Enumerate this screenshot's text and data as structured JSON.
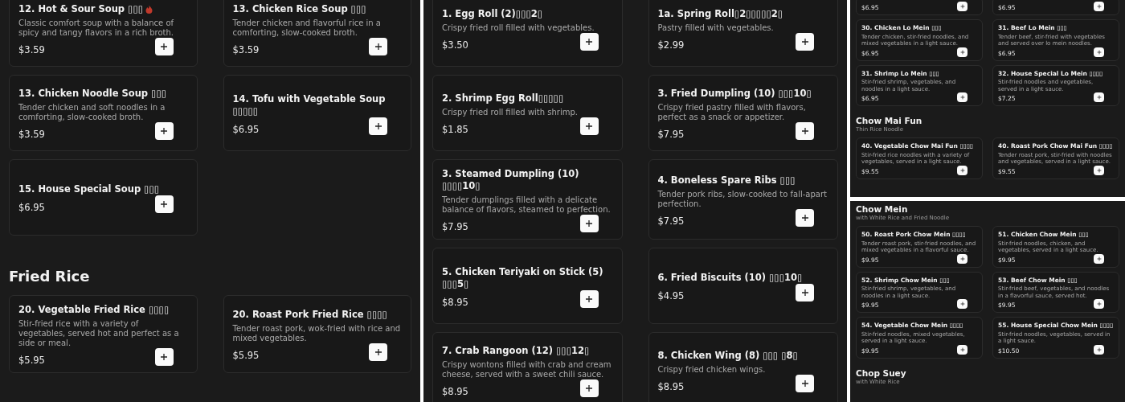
{
  "views": [
    {
      "kind": "large",
      "sections": [
        {
          "items": [
            {
              "name": "12. Hot & Sour Soup ▯▯▯",
              "spicy": true,
              "description": "Classic comfort soup with a balance of spicy and tangy flavors in a rich broth.",
              "price": "$3.59"
            },
            {
              "name": "13. Chicken Rice Soup ▯▯▯",
              "spicy": false,
              "description": "Tender chicken and flavorful rice in a comforting, slow-cooked broth.",
              "price": "$3.59"
            },
            {
              "name": "13. Chicken Noodle Soup ▯▯▯",
              "spicy": false,
              "description": "Tender chicken and soft noodles in a comforting, slow-cooked broth.",
              "price": "$3.59"
            },
            {
              "name": "14. Tofu with Vegetable Soup ▯▯▯▯▯",
              "spicy": false,
              "price": "$6.95"
            },
            {
              "name": "15. House Special Soup ▯▯▯",
              "spicy": false,
              "price": "$6.95"
            }
          ]
        },
        {
          "title": "Fried Rice",
          "items": [
            {
              "name": "20. Vegetable Fried Rice ▯▯▯▯",
              "spicy": false,
              "description": "Stir-fried rice with a variety of vegetables, served hot and perfect as a side or meal.",
              "price": "$5.95"
            },
            {
              "name": "20. Roast Pork Fried Rice ▯▯▯▯",
              "spicy": false,
              "description": "Tender roast pork, wok-fried with rice and mixed vegetables.",
              "price": "$5.95"
            }
          ]
        }
      ]
    },
    {
      "kind": "large",
      "sections": [
        {
          "items": [
            {
              "name": "1. Egg Roll (2)▯▯▯2▯",
              "spicy": false,
              "description": "Crispy fried roll filled with vegetables.",
              "price": "$3.50"
            },
            {
              "name": "1a. Spring Roll▯2▯▯▯▯▯2▯",
              "spicy": false,
              "description": "Pastry filled with vegetables.",
              "price": "$2.99"
            },
            {
              "name": "2. Shrimp Egg Roll▯▯▯▯▯",
              "spicy": false,
              "description": "Crispy fried roll filled with shrimp.",
              "price": "$1.85"
            },
            {
              "name": "3. Fried Dumpling (10) ▯▯▯10▯",
              "spicy": false,
              "description": "Crispy fried pastry filled with flavors, perfect as a snack or appetizer.",
              "price": "$7.95"
            },
            {
              "name": "3. Steamed Dumpling (10) ▯▯▯▯10▯",
              "spicy": false,
              "description": "Tender dumplings filled with a delicate balance of flavors, steamed to perfection.",
              "price": "$7.95"
            },
            {
              "name": "4. Boneless Spare Ribs ▯▯▯",
              "spicy": false,
              "description": "Tender pork ribs, slow-cooked to fall-apart perfection.",
              "price": "$7.95"
            },
            {
              "name": "5. Chicken Teriyaki on Stick (5) ▯▯▯5▯",
              "spicy": false,
              "price": "$8.95"
            },
            {
              "name": "6. Fried Biscuits (10) ▯▯▯10▯",
              "spicy": false,
              "price": "$4.95"
            },
            {
              "name": "7. Crab Rangoon (12) ▯▯▯12▯",
              "spicy": false,
              "description": "Crispy wontons filled with crab and cream cheese, served with a sweet chili sauce.",
              "price": "$8.95"
            },
            {
              "name": "8. Chicken Wing (8) ▯▯▯ ▯8▯",
              "spicy": false,
              "description": "Crispy fried chicken wings.",
              "price": "$8.95"
            }
          ]
        }
      ]
    },
    {
      "kind": "small",
      "sections": [
        {
          "items": [
            {
              "spicy": false,
              "price": "$6.95"
            },
            {
              "spicy": false,
              "price": "$6.95"
            },
            {
              "name": "30. Chicken Lo Mein ▯▯▯",
              "spicy": false,
              "description": "Tender chicken, stir-fried noodles, and mixed vegetables in a light sauce.",
              "price": "$6.95"
            },
            {
              "name": "31. Beef Lo Mein ▯▯▯",
              "spicy": false,
              "description": "Tender beef, stir-fried with vegetables and served over lo mein noodles.",
              "price": "$6.95"
            },
            {
              "name": "31. Shrimp Lo Mein ▯▯▯",
              "spicy": false,
              "description": "Stir-fried shrimp, vegetables, and noodles in a light sauce.",
              "price": "$6.95"
            },
            {
              "name": "32. House Special Lo Mein ▯▯▯▯",
              "spicy": false,
              "description": "Stir-fried noodles and vegetables, served in a light sauce.",
              "price": "$7.25"
            }
          ]
        },
        {
          "title": "Chow Mai Fun",
          "subtitle": "Thin Rice Noodle",
          "items": [
            {
              "name": "40. Vegetable Chow Mai Fun ▯▯▯▯",
              "spicy": false,
              "description": "Stir-fried rice noodles with a variety of vegetables, served in a light sauce.",
              "price": "$9.55"
            },
            {
              "name": "40. Roast Pork Chow Mai Fun ▯▯▯▯",
              "spicy": false,
              "description": "Tender roast pork, stir-fried with noodles and vegetables, served in a light sauce.",
              "price": "$9.55"
            }
          ]
        }
      ]
    },
    {
      "kind": "small",
      "sections": [
        {
          "title": "Chow Mein",
          "subtitle": "with White Rice and Fried Noodle",
          "items": [
            {
              "name": "50. Roast Pork Chow Mein ▯▯▯▯",
              "spicy": false,
              "description": "Tender roast pork, stir-fried noodles, and mixed vegetables in a flavorful sauce.",
              "price": "$9.95"
            },
            {
              "name": "51. Chicken Chow Mein ▯▯▯",
              "spicy": false,
              "description": "Stir-fried noodles, chicken, and vegetables, served in a light sauce.",
              "price": "$9.95"
            },
            {
              "name": "52. Shrimp Chow Mein ▯▯▯",
              "spicy": false,
              "description": "Stir-fried shrimp, vegetables, and noodles in a light sauce.",
              "price": "$9.95"
            },
            {
              "name": "53. Beef Chow Mein ▯▯▯",
              "spicy": false,
              "description": "Stir-fried beef, vegetables, and noodles in a flavorful sauce, served hot.",
              "price": "$9.95"
            },
            {
              "name": "54. Vegetable Chow Mein ▯▯▯▯",
              "spicy": false,
              "description": "Stir-fried noodles, mixed vegetables, served in a light sauce.",
              "price": "$9.95"
            },
            {
              "name": "55. House Special Chow Mein ▯▯▯▯",
              "spicy": false,
              "description": "Stir-fried noodles, vegetables, served in a light sauce.",
              "price": "$10.50"
            }
          ]
        },
        {
          "title": "Chop Suey",
          "subtitle": "with White Rice"
        }
      ]
    }
  ]
}
